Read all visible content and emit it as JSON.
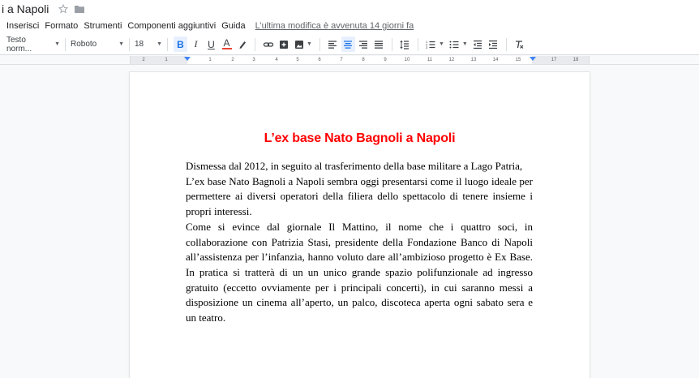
{
  "window": {
    "doc_title": "i a Napoli"
  },
  "menu": {
    "items": [
      "Inserisci",
      "Formato",
      "Strumenti",
      "Componenti aggiuntivi",
      "Guida"
    ],
    "last_edit": "L’ultima modifica è avvenuta 14 giorni fa"
  },
  "toolbar": {
    "style_select": "Testo norm...",
    "font_select": "Roboto",
    "font_size": "18",
    "bold": "B",
    "italic": "I",
    "underline": "U",
    "text_color": "A",
    "text_color_value": "#ea4335"
  },
  "ruler": {
    "numbers": [
      "2",
      "1",
      "1",
      "2",
      "3",
      "4",
      "5",
      "6",
      "7",
      "8",
      "9",
      "10",
      "11",
      "12",
      "13",
      "14",
      "15",
      "17",
      "18"
    ]
  },
  "document": {
    "heading": "L’ex base Nato Bagnoli a Napoli",
    "heading_color": "#ff0000",
    "paragraphs": [
      "Dismessa dal 2012, in seguito al trasferimento della base militare a Lago Patria,",
      "L’ex base Nato Bagnoli a Napoli  sembra oggi presentarsi come il luogo ideale per permettere ai diversi operatori della filiera dello spettacolo di tenere insieme i propri interessi.",
      "Come si evince dal giornale Il Mattino, il nome che i quattro soci, in collaborazione con Patrizia Stasi, presidente della Fondazione Banco di Napoli all’assistenza per l’infanzia, hanno voluto dare all’ambizioso progetto è Ex Base. In pratica si tratterà di un un unico grande spazio polifunzionale ad ingresso gratuito (eccetto ovviamente per i principali concerti), in cui saranno messi a disposizione un cinema all’aperto, un palco, discoteca aperta ogni sabato sera e un teatro."
    ]
  },
  "colors": {
    "accent": "#1a73e8",
    "active_bg": "#e8f0fe"
  }
}
